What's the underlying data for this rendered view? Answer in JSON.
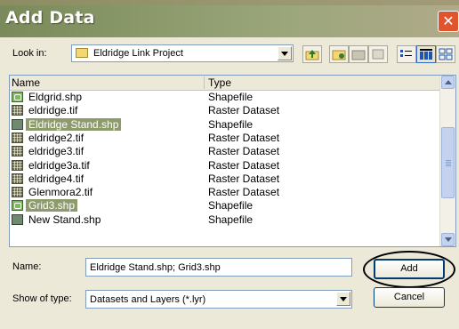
{
  "window": {
    "title": "Add Data",
    "close_icon": "close-icon"
  },
  "toolbar": {
    "look_in_label": "Look in:",
    "look_in_value": "Eldridge Link Project",
    "buttons": [
      "up-one-level-icon",
      "add-to-catalog-icon",
      "disconnect-icon",
      "delete-icon",
      "list-view-icon",
      "details-view-icon",
      "thumbnails-view-icon"
    ]
  },
  "list": {
    "columns": [
      "Name",
      "Type"
    ],
    "rows": [
      {
        "name": "Eldgrid.shp",
        "type": "Shapefile",
        "icon": "shp",
        "selected": false
      },
      {
        "name": "eldridge.tif",
        "type": "Raster Dataset",
        "icon": "tif",
        "selected": false
      },
      {
        "name": "Eldridge Stand.shp",
        "type": "Shapefile",
        "icon": "sel",
        "selected": true
      },
      {
        "name": "eldridge2.tif",
        "type": "Raster Dataset",
        "icon": "tif",
        "selected": false
      },
      {
        "name": "eldridge3.tif",
        "type": "Raster Dataset",
        "icon": "tif",
        "selected": false
      },
      {
        "name": "eldridge3a.tif",
        "type": "Raster Dataset",
        "icon": "tif",
        "selected": false
      },
      {
        "name": "eldridge4.tif",
        "type": "Raster Dataset",
        "icon": "tif",
        "selected": false
      },
      {
        "name": "Glenmora2.tif",
        "type": "Raster Dataset",
        "icon": "tif",
        "selected": false
      },
      {
        "name": "Grid3.shp",
        "type": "Shapefile",
        "icon": "shp",
        "selected": true
      },
      {
        "name": "New Stand.shp",
        "type": "Shapefile",
        "icon": "sel",
        "selected": false
      }
    ]
  },
  "form": {
    "name_label": "Name:",
    "name_value": "Eldridge Stand.shp; Grid3.shp",
    "type_label": "Show of type:",
    "type_value": "Datasets and Layers (*.lyr)",
    "add_label": "Add",
    "cancel_label": "Cancel"
  },
  "colors": {
    "selection": "#8c9a6c",
    "dialog_bg": "#ece9d8"
  }
}
